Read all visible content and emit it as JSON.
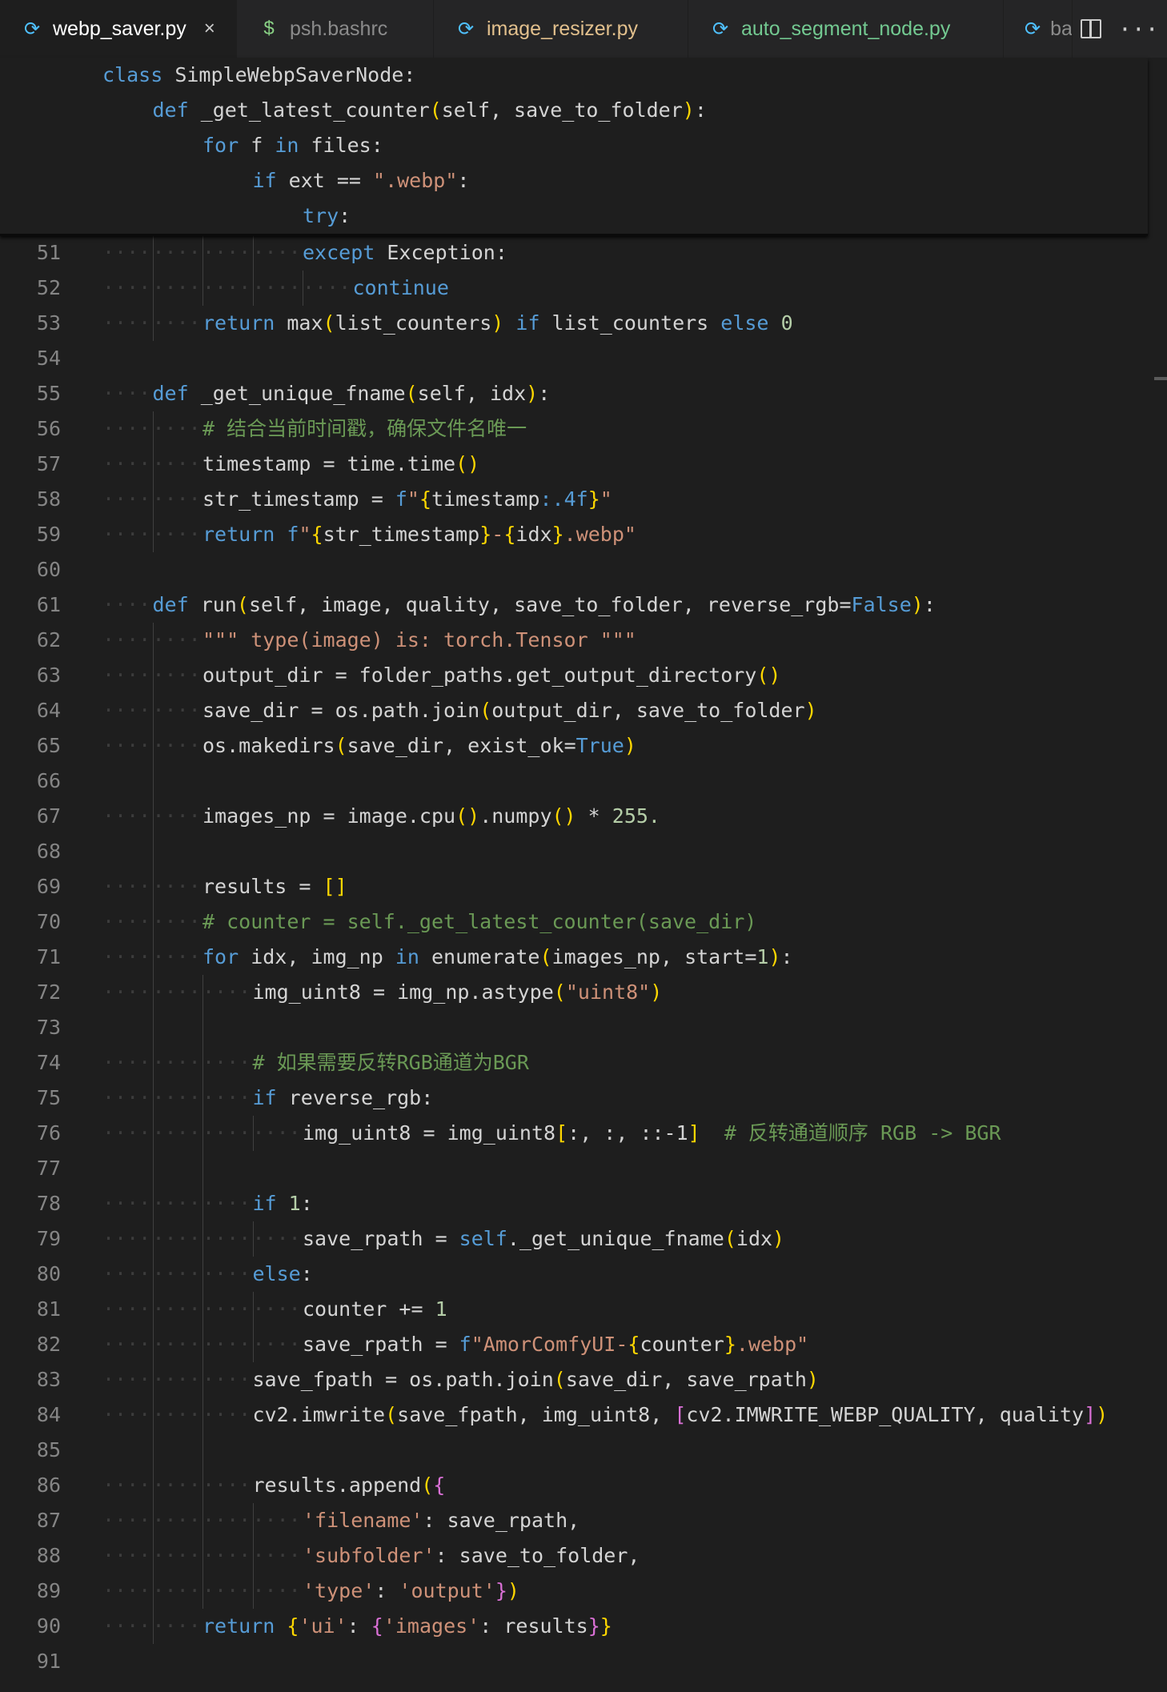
{
  "tabs": [
    {
      "label": "webp_saver.py",
      "icon": "python-icon",
      "color": "#ffffff",
      "active": true,
      "close": "×"
    },
    {
      "label": "psh.bashrc",
      "icon": "dollar-icon",
      "color": "#8b8b8b",
      "active": false
    },
    {
      "label": "image_resizer.py",
      "icon": "python-icon",
      "color": "#e2c08d",
      "active": false
    },
    {
      "label": "auto_segment_node.py",
      "icon": "python-icon",
      "color": "#73c991",
      "active": false
    },
    {
      "label": "ba",
      "icon": "python-icon",
      "color": "#8b8b8b",
      "active": false
    }
  ],
  "actions": {
    "more": "···"
  },
  "sticky": [
    {
      "indent": 0,
      "tokens": [
        [
          "kw",
          "class"
        ],
        [
          "pl",
          " SimpleWebpSaverNode:"
        ]
      ]
    },
    {
      "indent": 1,
      "tokens": [
        [
          "kw",
          "def"
        ],
        [
          "pl",
          " _get_latest_counter"
        ],
        [
          "b1",
          "("
        ],
        [
          "pl",
          "self, save_to_folder"
        ],
        [
          "b1",
          ")"
        ],
        [
          "pl",
          ":"
        ]
      ]
    },
    {
      "indent": 2,
      "tokens": [
        [
          "kw",
          "for"
        ],
        [
          "pl",
          " f "
        ],
        [
          "kw",
          "in"
        ],
        [
          "pl",
          " files:"
        ]
      ]
    },
    {
      "indent": 3,
      "tokens": [
        [
          "kw",
          "if"
        ],
        [
          "pl",
          " ext == "
        ],
        [
          "str",
          "\".webp\""
        ],
        [
          "pl",
          ":"
        ]
      ]
    },
    {
      "indent": 4,
      "tokens": [
        [
          "kw",
          "try"
        ],
        [
          "pl",
          ":"
        ]
      ]
    }
  ],
  "lines": [
    {
      "n": "51",
      "indent": 4,
      "tokens": [
        [
          "kw",
          "except"
        ],
        [
          "pl",
          " Exception:"
        ]
      ]
    },
    {
      "n": "52",
      "indent": 5,
      "tokens": [
        [
          "kw",
          "continue"
        ]
      ]
    },
    {
      "n": "53",
      "indent": 2,
      "tokens": [
        [
          "kw",
          "return"
        ],
        [
          "pl",
          " max"
        ],
        [
          "b1",
          "("
        ],
        [
          "pl",
          "list_counters"
        ],
        [
          "b1",
          ")"
        ],
        [
          "pl",
          " "
        ],
        [
          "kw",
          "if"
        ],
        [
          "pl",
          " list_counters "
        ],
        [
          "kw",
          "else"
        ],
        [
          "pl",
          " "
        ],
        [
          "num",
          "0"
        ]
      ]
    },
    {
      "n": "54",
      "indent": 0,
      "tokens": []
    },
    {
      "n": "55",
      "indent": 1,
      "tokens": [
        [
          "kw",
          "def"
        ],
        [
          "pl",
          " _get_unique_fname"
        ],
        [
          "b1",
          "("
        ],
        [
          "pl",
          "self, idx"
        ],
        [
          "b1",
          ")"
        ],
        [
          "pl",
          ":"
        ]
      ]
    },
    {
      "n": "56",
      "indent": 2,
      "tokens": [
        [
          "cmt",
          "# 结合当前时间戳，确保文件名唯一"
        ]
      ]
    },
    {
      "n": "57",
      "indent": 2,
      "tokens": [
        [
          "pl",
          "timestamp = time.time"
        ],
        [
          "b1",
          "()"
        ]
      ]
    },
    {
      "n": "58",
      "indent": 2,
      "tokens": [
        [
          "pl",
          "str_timestamp = "
        ],
        [
          "kw",
          "f"
        ],
        [
          "str",
          "\""
        ],
        [
          "b1",
          "{"
        ],
        [
          "pl",
          "timestamp"
        ],
        [
          "kw",
          ":.4f"
        ],
        [
          "b1",
          "}"
        ],
        [
          "str",
          "\""
        ]
      ]
    },
    {
      "n": "59",
      "indent": 2,
      "tokens": [
        [
          "kw",
          "return"
        ],
        [
          "pl",
          " "
        ],
        [
          "kw",
          "f"
        ],
        [
          "str",
          "\""
        ],
        [
          "b1",
          "{"
        ],
        [
          "pl",
          "str_timestamp"
        ],
        [
          "b1",
          "}"
        ],
        [
          "str",
          "-"
        ],
        [
          "b1",
          "{"
        ],
        [
          "pl",
          "idx"
        ],
        [
          "b1",
          "}"
        ],
        [
          "str",
          ".webp\""
        ]
      ]
    },
    {
      "n": "60",
      "indent": 0,
      "tokens": []
    },
    {
      "n": "61",
      "indent": 1,
      "tokens": [
        [
          "kw",
          "def"
        ],
        [
          "pl",
          " run"
        ],
        [
          "b1",
          "("
        ],
        [
          "pl",
          "self, image, quality, save_to_folder, reverse_rgb="
        ],
        [
          "kw",
          "False"
        ],
        [
          "b1",
          ")"
        ],
        [
          "pl",
          ":"
        ]
      ]
    },
    {
      "n": "62",
      "indent": 2,
      "tokens": [
        [
          "str",
          "\"\"\" type(image) is: torch.Tensor \"\"\""
        ]
      ]
    },
    {
      "n": "63",
      "indent": 2,
      "tokens": [
        [
          "pl",
          "output_dir = folder_paths.get_output_directory"
        ],
        [
          "b1",
          "()"
        ]
      ]
    },
    {
      "n": "64",
      "indent": 2,
      "tokens": [
        [
          "pl",
          "save_dir = os.path.join"
        ],
        [
          "b1",
          "("
        ],
        [
          "pl",
          "output_dir, save_to_folder"
        ],
        [
          "b1",
          ")"
        ]
      ]
    },
    {
      "n": "65",
      "indent": 2,
      "tokens": [
        [
          "pl",
          "os.makedirs"
        ],
        [
          "b1",
          "("
        ],
        [
          "pl",
          "save_dir, exist_ok="
        ],
        [
          "kw",
          "True"
        ],
        [
          "b1",
          ")"
        ]
      ]
    },
    {
      "n": "66",
      "indent": 0,
      "tokens": []
    },
    {
      "n": "67",
      "indent": 2,
      "tokens": [
        [
          "pl",
          "images_np = image.cpu"
        ],
        [
          "b1",
          "()"
        ],
        [
          "pl",
          ".numpy"
        ],
        [
          "b1",
          "()"
        ],
        [
          "pl",
          " * "
        ],
        [
          "num",
          "255."
        ]
      ]
    },
    {
      "n": "68",
      "indent": 0,
      "tokens": []
    },
    {
      "n": "69",
      "indent": 2,
      "tokens": [
        [
          "pl",
          "results = "
        ],
        [
          "b1",
          "[]"
        ]
      ]
    },
    {
      "n": "70",
      "indent": 2,
      "tokens": [
        [
          "cmt",
          "# counter = self._get_latest_counter(save_dir)"
        ]
      ]
    },
    {
      "n": "71",
      "indent": 2,
      "tokens": [
        [
          "kw",
          "for"
        ],
        [
          "pl",
          " idx, img_np "
        ],
        [
          "kw",
          "in"
        ],
        [
          "pl",
          " enumerate"
        ],
        [
          "b1",
          "("
        ],
        [
          "pl",
          "images_np, start="
        ],
        [
          "num",
          "1"
        ],
        [
          "b1",
          ")"
        ],
        [
          "pl",
          ":"
        ]
      ]
    },
    {
      "n": "72",
      "indent": 3,
      "tokens": [
        [
          "pl",
          "img_uint8 = img_np.astype"
        ],
        [
          "b1",
          "("
        ],
        [
          "str",
          "\"uint8\""
        ],
        [
          "b1",
          ")"
        ]
      ]
    },
    {
      "n": "73",
      "indent": 0,
      "tokens": []
    },
    {
      "n": "74",
      "indent": 3,
      "tokens": [
        [
          "cmt",
          "# 如果需要反转RGB通道为BGR"
        ]
      ]
    },
    {
      "n": "75",
      "indent": 3,
      "tokens": [
        [
          "kw",
          "if"
        ],
        [
          "pl",
          " reverse_rgb:"
        ]
      ]
    },
    {
      "n": "76",
      "indent": 4,
      "tokens": [
        [
          "pl",
          "img_uint8 = img_uint8"
        ],
        [
          "b1",
          "["
        ],
        [
          "pl",
          ":, :, ::-1"
        ],
        [
          "b1",
          "]"
        ],
        [
          "pl",
          "  "
        ],
        [
          "cmt",
          "# 反转通道顺序 RGB -> BGR"
        ]
      ]
    },
    {
      "n": "77",
      "indent": 0,
      "tokens": []
    },
    {
      "n": "78",
      "indent": 3,
      "tokens": [
        [
          "kw",
          "if"
        ],
        [
          "pl",
          " "
        ],
        [
          "num",
          "1"
        ],
        [
          "pl",
          ":"
        ]
      ]
    },
    {
      "n": "79",
      "indent": 4,
      "tokens": [
        [
          "pl",
          "save_rpath = "
        ],
        [
          "kw",
          "self"
        ],
        [
          "pl",
          "._get_unique_fname"
        ],
        [
          "b1",
          "("
        ],
        [
          "pl",
          "idx"
        ],
        [
          "b1",
          ")"
        ]
      ]
    },
    {
      "n": "80",
      "indent": 3,
      "tokens": [
        [
          "kw",
          "else"
        ],
        [
          "pl",
          ":"
        ]
      ]
    },
    {
      "n": "81",
      "indent": 4,
      "tokens": [
        [
          "pl",
          "counter += "
        ],
        [
          "num",
          "1"
        ]
      ]
    },
    {
      "n": "82",
      "indent": 4,
      "tokens": [
        [
          "pl",
          "save_rpath = "
        ],
        [
          "kw",
          "f"
        ],
        [
          "str",
          "\"AmorComfyUI-"
        ],
        [
          "b1",
          "{"
        ],
        [
          "pl",
          "counter"
        ],
        [
          "b1",
          "}"
        ],
        [
          "str",
          ".webp\""
        ]
      ]
    },
    {
      "n": "83",
      "indent": 3,
      "tokens": [
        [
          "pl",
          "save_fpath = os.path.join"
        ],
        [
          "b1",
          "("
        ],
        [
          "pl",
          "save_dir, save_rpath"
        ],
        [
          "b1",
          ")"
        ]
      ]
    },
    {
      "n": "84",
      "indent": 3,
      "tokens": [
        [
          "pl",
          "cv2.imwrite"
        ],
        [
          "b1",
          "("
        ],
        [
          "pl",
          "save_fpath, img_uint8, "
        ],
        [
          "b2",
          "["
        ],
        [
          "pl",
          "cv2.IMWRITE_WEBP_QUALITY, quality"
        ],
        [
          "b2",
          "]"
        ],
        [
          "b1",
          ")"
        ]
      ]
    },
    {
      "n": "85",
      "indent": 0,
      "tokens": []
    },
    {
      "n": "86",
      "indent": 3,
      "tokens": [
        [
          "pl",
          "results.append"
        ],
        [
          "b1",
          "("
        ],
        [
          "b2",
          "{"
        ]
      ]
    },
    {
      "n": "87",
      "indent": 4,
      "tokens": [
        [
          "str",
          "'filename'"
        ],
        [
          "pl",
          ": save_rpath,"
        ]
      ]
    },
    {
      "n": "88",
      "indent": 4,
      "tokens": [
        [
          "str",
          "'subfolder'"
        ],
        [
          "pl",
          ": save_to_folder,"
        ]
      ]
    },
    {
      "n": "89",
      "indent": 4,
      "tokens": [
        [
          "str",
          "'type'"
        ],
        [
          "pl",
          ": "
        ],
        [
          "str",
          "'output'"
        ],
        [
          "b2",
          "}"
        ],
        [
          "b1",
          ")"
        ]
      ]
    },
    {
      "n": "90",
      "indent": 2,
      "tokens": [
        [
          "kw",
          "return"
        ],
        [
          "pl",
          " "
        ],
        [
          "b1",
          "{"
        ],
        [
          "str",
          "'ui'"
        ],
        [
          "pl",
          ": "
        ],
        [
          "b2",
          "{"
        ],
        [
          "str",
          "'images'"
        ],
        [
          "pl",
          ": results"
        ],
        [
          "b2",
          "}"
        ],
        [
          "b1",
          "}"
        ]
      ]
    },
    {
      "n": "91",
      "indent": 0,
      "tokens": []
    }
  ]
}
